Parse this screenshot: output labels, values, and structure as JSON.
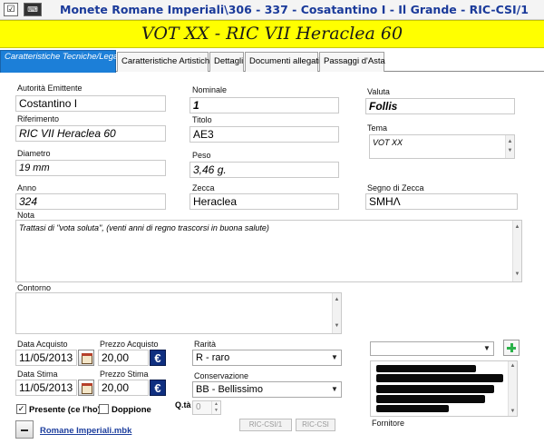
{
  "window": {
    "title": "Monete Romane Imperiali\\306 - 337 - Cosatantino I - Il Grande - RIC-CSI/1",
    "system_icon": "checkbox-icon",
    "keyboard_icon": "keyboard-icon"
  },
  "banner": {
    "text": "VOT XX - RIC VII Heraclea 60",
    "color": "#ffff00"
  },
  "tabs": [
    {
      "label": "Caratteristiche Tecniche/Legali",
      "active": true
    },
    {
      "label": "Caratteristiche Artistiche"
    },
    {
      "label": "Dettagli"
    },
    {
      "label": "Documenti allegati"
    },
    {
      "label": "Passaggi d'Asta"
    }
  ],
  "fields": {
    "autorita": {
      "label": "Autorità Emittente",
      "value": "Costantino I"
    },
    "nominale": {
      "label": "Nominale",
      "value": "1"
    },
    "valuta": {
      "label": "Valuta",
      "value": "Follis"
    },
    "riferimento": {
      "label": "Riferimento",
      "value": "RIC VII Heraclea 60"
    },
    "titolo": {
      "label": "Titolo",
      "value": "AE3"
    },
    "tema": {
      "label": "Tema",
      "value": "VOT XX"
    },
    "diametro": {
      "label": "Diametro",
      "value": "19 mm"
    },
    "peso": {
      "label": "Peso",
      "value": "3,46 g."
    },
    "anno": {
      "label": "Anno",
      "value": "324"
    },
    "zecca": {
      "label": "Zecca",
      "value": "Heraclea"
    },
    "segno_zecca": {
      "label": "Segno di Zecca",
      "value": "SMHΛ"
    },
    "nota": {
      "label": "Nota",
      "value": "Trattasi di \"vota soluta\", (venti anni di regno trascorsi in buona salute)"
    },
    "contorno": {
      "label": "Contorno",
      "value": ""
    },
    "data_acquisto": {
      "label": "Data Acquisto",
      "value": "11/05/2013"
    },
    "prezzo_acquisto": {
      "label": "Prezzo Acquisto",
      "value": "20,00"
    },
    "rarita": {
      "label": "Rarità",
      "value": "R - raro"
    },
    "data_stima": {
      "label": "Data Stima",
      "value": "11/05/2013"
    },
    "prezzo_stima": {
      "label": "Prezzo Stima",
      "value": "20,00"
    },
    "conservazione": {
      "label": "Conservazione",
      "value": "BB - Bellissimo"
    },
    "quantita": {
      "label": "Q.tà",
      "value": "0"
    },
    "fornitore": {
      "label": "Fornitore",
      "value": ""
    }
  },
  "checkboxes": {
    "presente": {
      "label": "Presente (ce l'ho)",
      "checked": true,
      "mark": "✓"
    },
    "doppione": {
      "label": "Doppione",
      "checked": false
    }
  },
  "buttons": {
    "ric_csi_1": "RIC-CSI/1",
    "ric_csi": "RIC-CSI",
    "euro_symbol": "€"
  },
  "footer": {
    "file_link": "Romane Imperiali.mbk"
  },
  "colors": {
    "title_text": "#1a3a9a",
    "active_tab": "#1c7fd8",
    "euro_button": "#0f2f80",
    "add_button": "#2bb24a"
  }
}
